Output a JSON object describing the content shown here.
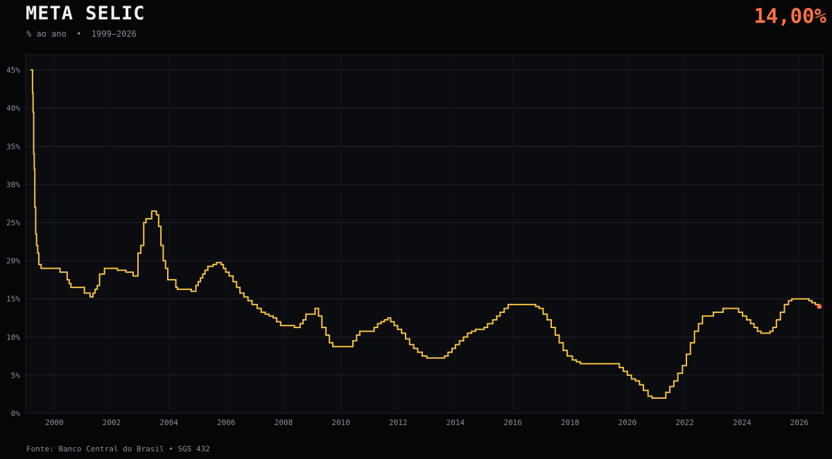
{
  "header": {
    "title": "META SELIC",
    "subtitle": "% ao ano  •  1999–2026",
    "current_value": "14,00%"
  },
  "footer": {
    "source": "Fonte: Banco Central do Brasil • SGS 432"
  },
  "colors": {
    "line": "#f5c242",
    "accent": "#ff7043",
    "grid": "#1f2228",
    "background": "#050608",
    "plot_bg": "#0b0c10"
  },
  "chart_data": {
    "type": "line",
    "step": true,
    "title": "META SELIC",
    "subtitle": "% ao ano  •  1999–2026",
    "xlabel": "",
    "ylabel": "",
    "xlim": [
      1999.0,
      2026.85
    ],
    "ylim": [
      0,
      47
    ],
    "grid": true,
    "x_ticks": [
      2000,
      2002,
      2004,
      2006,
      2008,
      2010,
      2012,
      2014,
      2016,
      2018,
      2020,
      2022,
      2024,
      2026
    ],
    "y_ticks": [
      0,
      5,
      10,
      15,
      20,
      25,
      30,
      35,
      40,
      45
    ],
    "y_tick_suffix": "%",
    "series": [
      {
        "x": [
          1999.17,
          1999.22,
          1999.24,
          1999.26,
          1999.28,
          1999.3,
          1999.32,
          1999.35,
          1999.38,
          1999.42,
          1999.46,
          1999.54,
          1999.7,
          1999.75,
          2000.2,
          2000.45,
          2000.52,
          2000.58,
          2001.0,
          2001.05,
          2001.25,
          2001.35,
          2001.42,
          2001.5,
          2001.58,
          2001.75,
          2002.1,
          2002.2,
          2002.5,
          2002.75,
          2002.85,
          2002.92,
          2003.02,
          2003.12,
          2003.2,
          2003.4,
          2003.48,
          2003.56,
          2003.64,
          2003.72,
          2003.8,
          2003.88,
          2003.96,
          2004.24,
          2004.3,
          2004.78,
          2004.86,
          2004.94,
          2005.02,
          2005.1,
          2005.18,
          2005.26,
          2005.36,
          2005.54,
          2005.66,
          2005.74,
          2005.82,
          2005.9,
          2005.98,
          2006.1,
          2006.24,
          2006.36,
          2006.48,
          2006.62,
          2006.76,
          2006.9,
          2007.08,
          2007.22,
          2007.36,
          2007.5,
          2007.64,
          2007.76,
          2007.9,
          2008.38,
          2008.48,
          2008.58,
          2008.68,
          2008.78,
          2009.1,
          2009.22,
          2009.34,
          2009.48,
          2009.6,
          2009.72,
          2010.34,
          2010.42,
          2010.55,
          2010.66,
          2011.04,
          2011.16,
          2011.28,
          2011.4,
          2011.52,
          2011.64,
          2011.74,
          2011.86,
          2011.98,
          2012.12,
          2012.26,
          2012.4,
          2012.54,
          2012.68,
          2012.84,
          2013.0,
          2013.5,
          2013.62,
          2013.74,
          2013.88,
          2014.0,
          2014.14,
          2014.28,
          2014.42,
          2014.56,
          2014.7,
          2014.86,
          2015.0,
          2015.12,
          2015.3,
          2015.44,
          2015.56,
          2015.7,
          2015.84,
          2015.96,
          2016.1,
          2016.24,
          2016.38,
          2016.52,
          2016.66,
          2016.8,
          2016.92,
          2017.06,
          2017.2,
          2017.34,
          2017.48,
          2017.62,
          2017.76,
          2017.9,
          2018.08,
          2018.22,
          2018.36,
          2019.3,
          2019.6,
          2019.72,
          2019.86,
          2020.0,
          2020.14,
          2020.28,
          2020.42,
          2020.56,
          2020.72,
          2020.86,
          2021.2,
          2021.34,
          2021.48,
          2021.62,
          2021.76,
          2021.92,
          2022.06,
          2022.2,
          2022.34,
          2022.48,
          2022.62,
          2023.0,
          2023.34,
          2023.58,
          2023.74,
          2023.88,
          2024.02,
          2024.16,
          2024.3,
          2024.42,
          2024.54,
          2024.66,
          2024.82,
          2024.98,
          2025.08,
          2025.2,
          2025.34,
          2025.48,
          2025.62,
          2025.74,
          2025.88,
          2026.0,
          2026.12,
          2026.24,
          2026.34,
          2026.44,
          2026.56,
          2026.7
        ],
        "y": [
          45,
          45,
          42,
          39.5,
          34,
          32,
          27,
          23.5,
          22,
          21,
          19.5,
          19,
          19,
          19,
          18.5,
          17.5,
          17,
          16.5,
          16.5,
          15.75,
          15.25,
          15.75,
          16.25,
          16.75,
          18.25,
          19,
          19,
          18.75,
          18.5,
          18,
          18,
          21,
          22,
          25,
          25.5,
          26.5,
          26.5,
          26,
          24.5,
          22,
          20,
          19,
          17.5,
          16.5,
          16.25,
          16,
          16,
          16.75,
          17.25,
          17.75,
          18.25,
          18.75,
          19.25,
          19.5,
          19.75,
          19.75,
          19.5,
          19,
          18.5,
          18,
          17.25,
          16.5,
          15.75,
          15.25,
          14.75,
          14.25,
          13.75,
          13.25,
          13,
          12.75,
          12.5,
          12,
          11.5,
          11.25,
          11.25,
          11.75,
          12.25,
          13,
          13.75,
          12.75,
          11.25,
          10.25,
          9.25,
          8.75,
          8.75,
          9.5,
          10.25,
          10.75,
          10.75,
          11.25,
          11.75,
          12,
          12.25,
          12.5,
          12,
          11.5,
          11,
          10.5,
          9.75,
          9,
          8.5,
          8,
          7.5,
          7.25,
          7.25,
          7.5,
          8,
          8.5,
          9,
          9.5,
          10,
          10.5,
          10.75,
          11,
          11,
          11.25,
          11.75,
          12.25,
          12.75,
          13.25,
          13.75,
          14.25,
          14.25,
          14.25,
          14.25,
          14.25,
          14.25,
          14.25,
          14,
          13.75,
          13,
          12.25,
          11.25,
          10.25,
          9.25,
          8.25,
          7.5,
          7,
          6.75,
          6.5,
          6.5,
          6.5,
          6,
          5.5,
          5,
          4.5,
          4.25,
          3.75,
          3,
          2.25,
          2,
          2,
          2.75,
          3.5,
          4.25,
          5.25,
          6.25,
          7.75,
          9.25,
          10.75,
          11.75,
          12.75,
          13.25,
          13.75,
          13.75,
          13.75,
          13.25,
          12.75,
          12.25,
          11.75,
          11.25,
          10.75,
          10.5,
          10.5,
          10.75,
          11.25,
          12.25,
          13.25,
          14.25,
          14.75,
          15,
          15,
          15,
          15,
          15,
          14.75,
          14.5,
          14.25,
          14
        ]
      }
    ],
    "last_point": {
      "x": 2026.7,
      "y": 14,
      "label": "14,00%"
    }
  }
}
